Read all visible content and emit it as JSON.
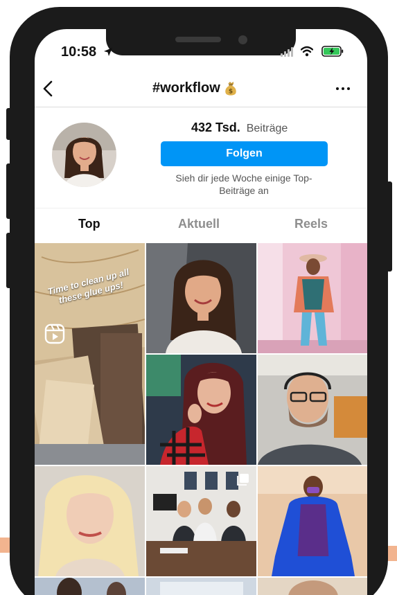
{
  "status_bar": {
    "time": "10:58"
  },
  "header": {
    "title": "#workflow",
    "title_emoji": "moneybag-icon"
  },
  "profile": {
    "posts_count": "432 Tsd.",
    "posts_label": "Beiträge",
    "follow_label": "Folgen",
    "hint": "Sieh dir jede Woche einige Top-Beiträge an"
  },
  "tabs": [
    {
      "label": "Top",
      "active": true
    },
    {
      "label": "Aktuell",
      "active": false
    },
    {
      "label": "Reels",
      "active": false
    }
  ],
  "grid": {
    "reel_caption": "Time to clean up all these glue ups!"
  },
  "colors": {
    "accent": "#0095f6",
    "frame": "#1b1b1b",
    "battery": "#34c759"
  }
}
